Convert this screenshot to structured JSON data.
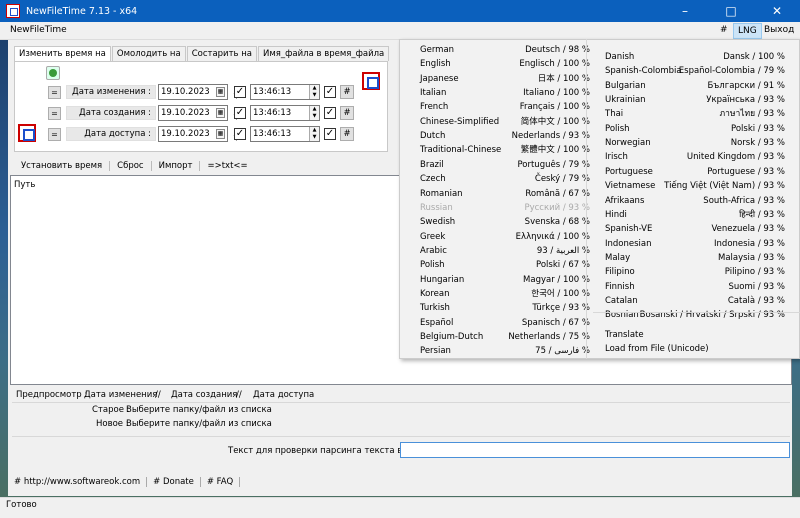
{
  "window": {
    "title": "NewFileTime 7.13 - x64",
    "minimize_icon": "–",
    "maximize_icon": "□",
    "close_icon": "✕"
  },
  "menubar": {
    "app": "NewFileTime",
    "hash": "#",
    "lng": "LNG",
    "exit": "Выход"
  },
  "tabs": [
    "Изменить время на",
    "Омолодить на",
    "Состарить на",
    "Имя_файла в время_файла"
  ],
  "rows": [
    {
      "eq": "=",
      "label": "Дата изменения :",
      "date": "19.10.2023",
      "time": "13:46:13",
      "hash": "#"
    },
    {
      "eq": "=",
      "label": "Дата создания :",
      "date": "19.10.2023",
      "time": "13:46:13",
      "hash": "#"
    },
    {
      "eq": "=",
      "label": "Дата доступа :",
      "date": "19.10.2023",
      "time": "13:46:13",
      "hash": "#"
    }
  ],
  "toolbar": [
    "Установить время",
    "Сброс",
    "Импорт",
    "=>txt<="
  ],
  "list": {
    "column": "Путь"
  },
  "preview": {
    "label": "Предпросмотр :",
    "c1": "Дата изменения",
    "sep1": "//",
    "c2": "Дата создания",
    "sep2": "//",
    "c3": "Дата доступа",
    "old_label": "Старое :",
    "old_value": "Выберите папку/файл из списка",
    "new_label": "Новое :",
    "new_value": "Выберите папку/файл из списка"
  },
  "parse": {
    "label": "Текст для проверки парсинга текста во время",
    "value": ""
  },
  "links": [
    "# http://www.softwareok.com",
    "# Donate",
    "# FAQ"
  ],
  "status": "Готово",
  "languages_left": [
    [
      "German",
      "Deutsch / 98 %"
    ],
    [
      "English",
      "Englisch / 100 %"
    ],
    [
      "Japanese",
      "日本 / 100 %"
    ],
    [
      "Italian",
      "Italiano / 100 %"
    ],
    [
      "French",
      "Français / 100 %"
    ],
    [
      "Chinese-Simplified",
      "简体中文 / 100 %"
    ],
    [
      "Dutch",
      "Nederlands / 93 %"
    ],
    [
      "Traditional-Chinese",
      "繁體中文 / 100 %"
    ],
    [
      "Brazil",
      "Português / 79 %"
    ],
    [
      "Czech",
      "Český / 79 %"
    ],
    [
      "Romanian",
      "Română / 67 %"
    ],
    [
      "Russian",
      "Русский / 93 %"
    ],
    [
      "Swedish",
      "Svenska / 68 %"
    ],
    [
      "Greek",
      "Ελληνικά / 100 %"
    ],
    [
      "Arabic",
      "93 / العربية %"
    ],
    [
      "Polish",
      "Polski / 67 %"
    ],
    [
      "Hungarian",
      "Magyar / 100 %"
    ],
    [
      "Korean",
      "한국어 / 100 %"
    ],
    [
      "Turkish",
      "Türkçe / 93 %"
    ],
    [
      "Español",
      "Spanisch / 67 %"
    ],
    [
      "Belgium-Dutch",
      "Netherlands / 75 %"
    ],
    [
      "Persian",
      "75 / فارسی %"
    ]
  ],
  "languages_right": [
    [
      "Danish",
      "Dansk / 100 %"
    ],
    [
      "Spanish-Colombia",
      "Español-Colombia / 79 %"
    ],
    [
      "Bulgarian",
      "Български / 91 %"
    ],
    [
      "Ukrainian",
      "Українська / 93 %"
    ],
    [
      "Thai",
      "ภาษาไทย / 93 %"
    ],
    [
      "Polish",
      "Polski / 93 %"
    ],
    [
      "Norwegian",
      "Norsk / 93 %"
    ],
    [
      "Irisch",
      "United Kingdom / 93 %"
    ],
    [
      "Portuguese",
      "Portuguese / 93 %"
    ],
    [
      "Vietnamese",
      "Tiếng Việt (Việt Nam) / 93 %"
    ],
    [
      "Afrikaans",
      "South-Africa / 93 %"
    ],
    [
      "Hindi",
      "हिन्दी / 93 %"
    ],
    [
      "Spanish-VE",
      "Venezuela / 93 %"
    ],
    [
      "Indonesian",
      "Indonesia / 93 %"
    ],
    [
      "Malay",
      "Malaysia / 93 %"
    ],
    [
      "Filipino",
      "Pilipino / 93 %"
    ],
    [
      "Finnish",
      "Suomi / 93 %"
    ],
    [
      "Catalan",
      "Català / 93 %"
    ],
    [
      "Bosnian",
      "Bosanski / Hrvatski / Srpski / 93 %"
    ]
  ],
  "lang_extra": [
    "Translate",
    "Load from File (Unicode)"
  ],
  "disabled_language": "Russian"
}
